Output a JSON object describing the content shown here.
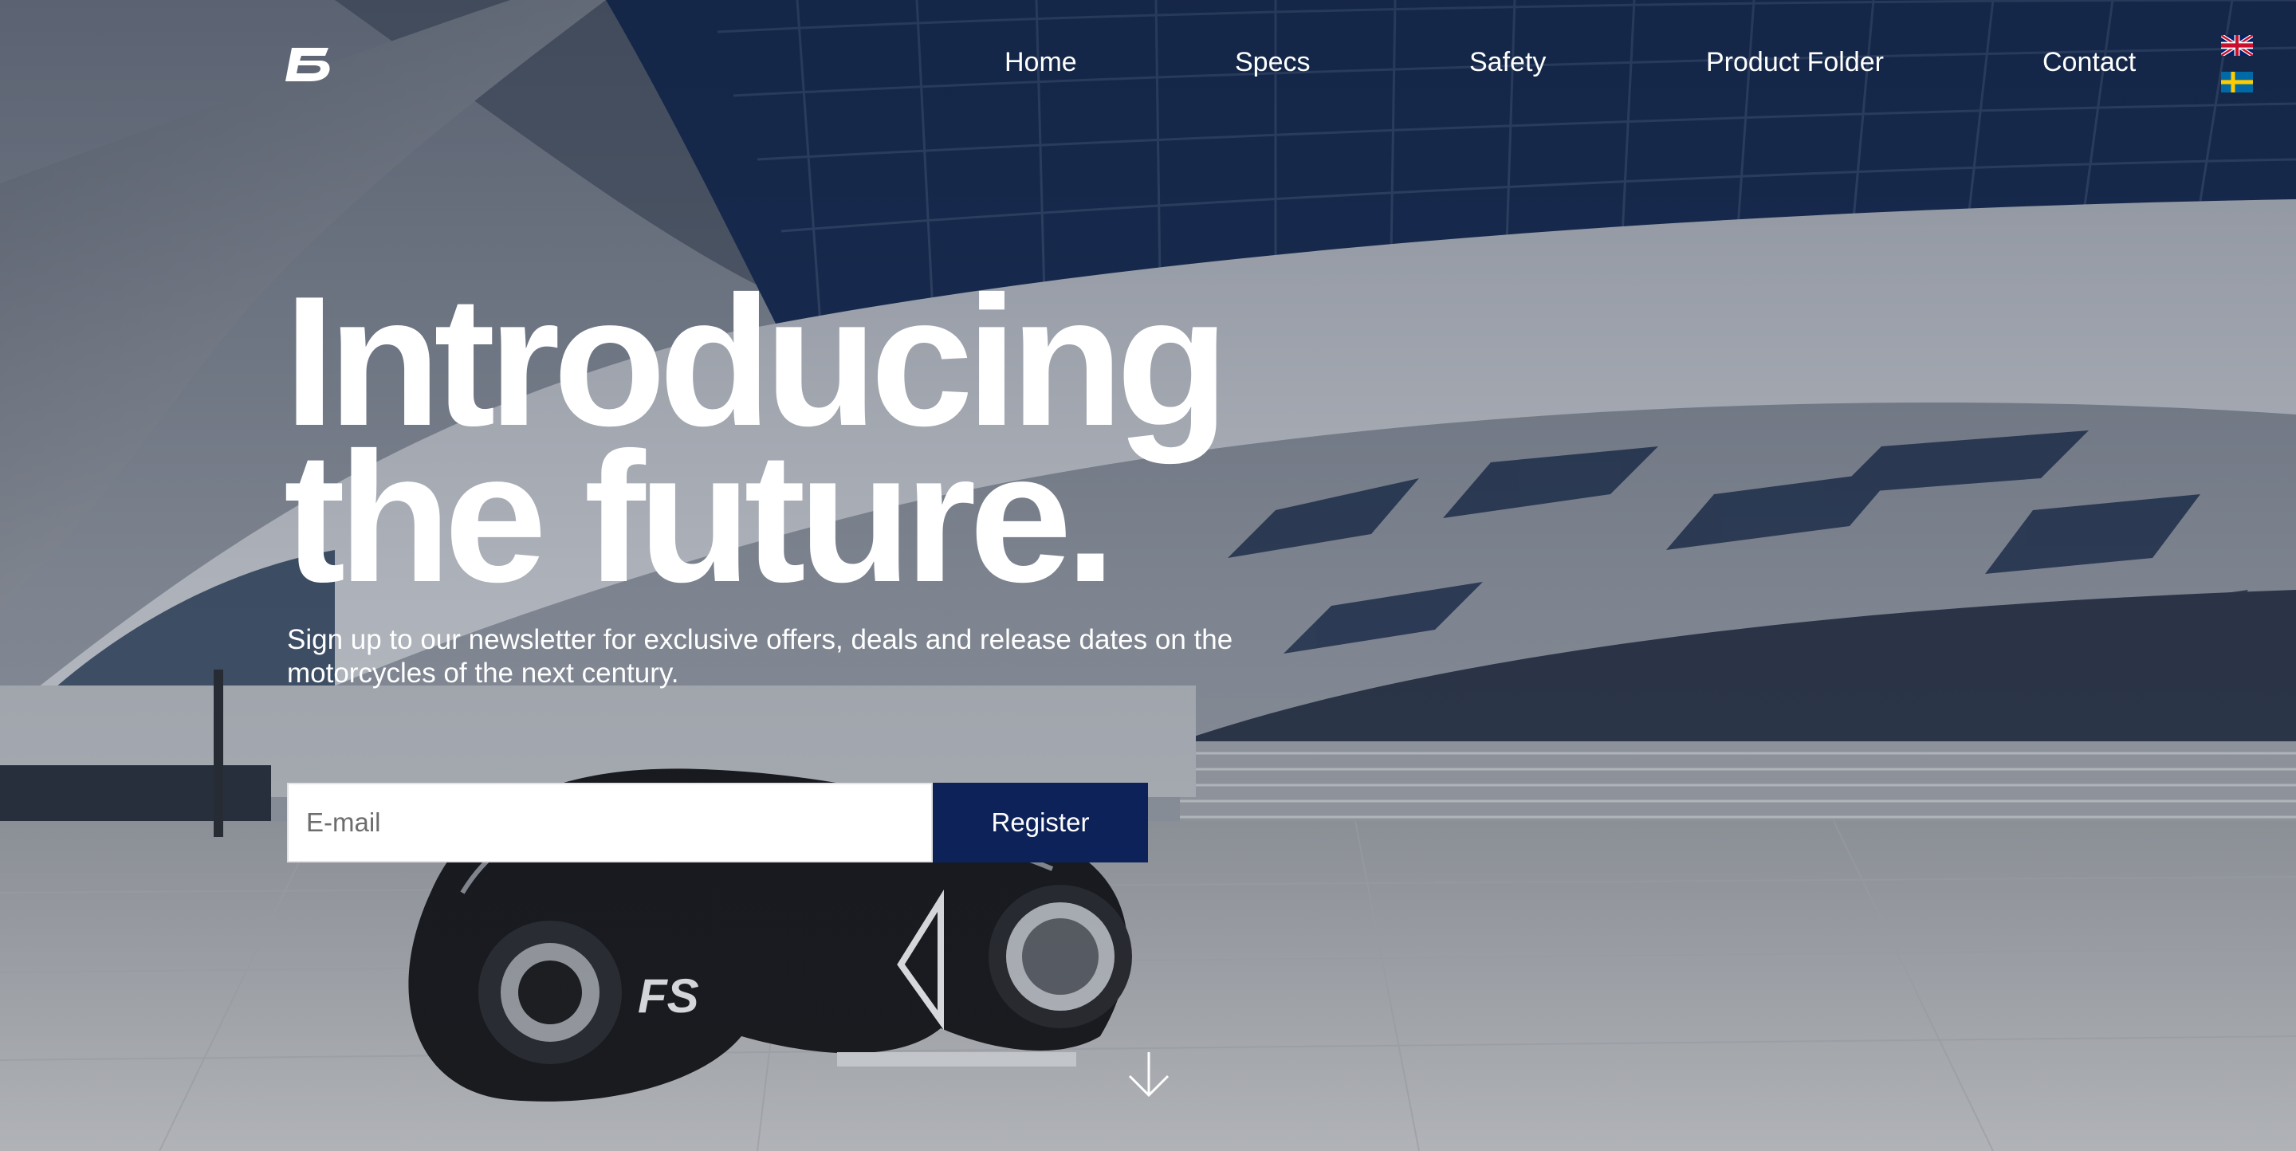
{
  "nav": {
    "items": [
      {
        "label": "Home"
      },
      {
        "label": "Specs"
      },
      {
        "label": "Safety"
      },
      {
        "label": "Product Folder"
      },
      {
        "label": "Contact"
      }
    ]
  },
  "languages": [
    "English",
    "Swedish"
  ],
  "hero": {
    "headline_line1": "Introducing",
    "headline_line2": "the future.",
    "subtitle": "Sign up to our newsletter for exclusive offers, deals and release dates on the motorcycles of the next century."
  },
  "signup": {
    "email_placeholder": "E-mail",
    "email_value": "",
    "register_label": "Register"
  },
  "icons": {
    "logo": "fs-logo-icon",
    "scroll": "arrow-down-icon",
    "flag_uk": "uk-flag-icon",
    "flag_se": "sweden-flag-icon"
  },
  "colors": {
    "register_button": "#0d2259",
    "text": "#ffffff"
  }
}
